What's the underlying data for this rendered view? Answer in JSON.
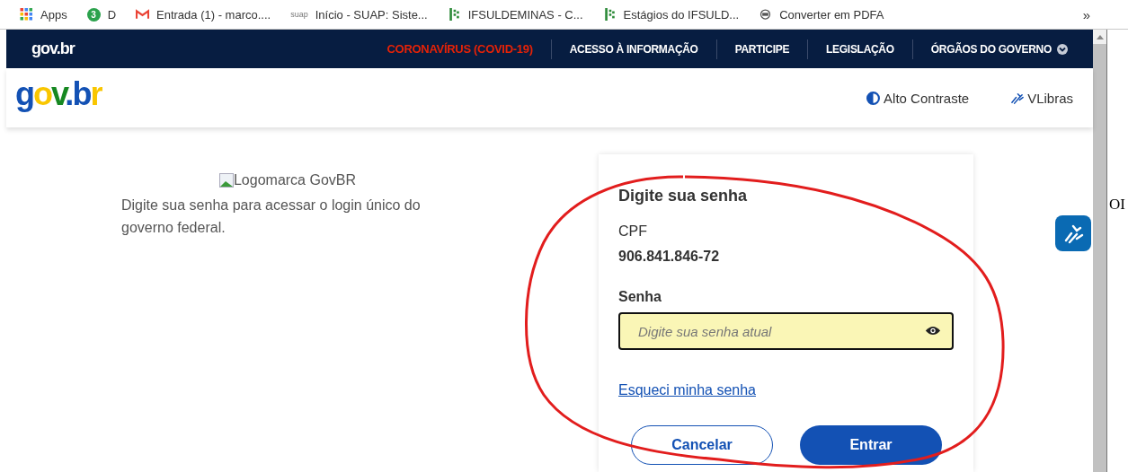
{
  "bookmarks": [
    {
      "kind": "apps",
      "label": "Apps"
    },
    {
      "kind": "badge",
      "badge": "3",
      "label": "D"
    },
    {
      "kind": "mail",
      "label": "Entrada (1) - marco...."
    },
    {
      "kind": "wordmark",
      "icon_text": "suap",
      "label": "Início - SUAP: Siste..."
    },
    {
      "kind": "blocks",
      "label": "IFSULDEMINAS - C..."
    },
    {
      "kind": "blocks",
      "label": "Estágios do IFSULD..."
    },
    {
      "kind": "converter",
      "label": "Converter em PDFA"
    }
  ],
  "bookmarks_overflow": "»",
  "nav": {
    "logo": "gov.br",
    "items": [
      {
        "label": "CORONAVÍRUS (COVID-19)",
        "kind": "alert"
      },
      {
        "label": "ACESSO À INFORMAÇÃO",
        "kind": "link"
      },
      {
        "label": "PARTICIPE",
        "kind": "link"
      },
      {
        "label": "LEGISLAÇÃO",
        "kind": "link"
      },
      {
        "label": "ÓRGÃOS DO GOVERNO",
        "kind": "dropdown"
      }
    ]
  },
  "header": {
    "logo": "gov.br",
    "actions": [
      {
        "label": "Alto Contraste",
        "kind": "contrast"
      },
      {
        "label": "VLibras",
        "kind": "signs"
      }
    ]
  },
  "intro": {
    "image_alt": "Logomarca GovBR",
    "text": "Digite sua senha para acessar o login único do governo federal."
  },
  "card": {
    "title": "Digite sua senha",
    "cpf_label": "CPF",
    "cpf_value": "906.841.846-72",
    "password_label": "Senha",
    "password_placeholder": "Digite sua senha atual",
    "forgot_link": "Esqueci minha senha",
    "buttons": [
      {
        "label": "Cancelar",
        "kind": "secondary"
      },
      {
        "label": "Entrar",
        "kind": "primary"
      }
    ]
  },
  "side_text": "OI"
}
